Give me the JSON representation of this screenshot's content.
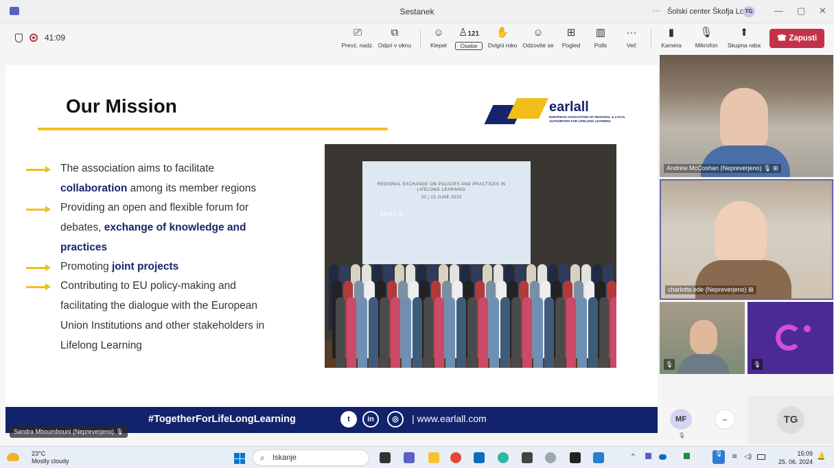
{
  "window": {
    "title": "Sestanek",
    "more": "···",
    "org": "Šolski center Škofja Loka",
    "org_badge": "TG",
    "minimize": "—",
    "restore": "▢",
    "close": "✕"
  },
  "toolbar": {
    "timer": "41:09",
    "buttons": [
      {
        "label": "Prevz. nadz.",
        "icon": "share-control-icon"
      },
      {
        "label": "Odpri v oknu",
        "icon": "popout-icon"
      },
      {
        "label": "Klepet",
        "icon": "chat-icon"
      },
      {
        "label": "Osebe",
        "icon": "people-icon",
        "count": "121"
      },
      {
        "label": "Dvigni roko",
        "icon": "raise-hand-icon"
      },
      {
        "label": "Odzovite se",
        "icon": "react-icon"
      },
      {
        "label": "Pogled",
        "icon": "view-icon"
      },
      {
        "label": "Polls",
        "icon": "polls-icon"
      },
      {
        "label": "Več",
        "icon": "more-icon"
      },
      {
        "label": "Kamera",
        "icon": "camera-off-icon"
      },
      {
        "label": "Mikrofon",
        "icon": "mic-off-icon"
      },
      {
        "label": "Skupna raba",
        "icon": "share-icon"
      }
    ],
    "leave_label": "Zapusti",
    "leave_color": "#c4314b"
  },
  "slide": {
    "title": "Our Mission",
    "logo_name": "earlall",
    "logo_sub": "EUROPEAN ASSOCIATION OF REGIONAL & LOCAL AUTHORITIES FOR LIFELONG LEARNING",
    "bullets": [
      {
        "lines": [
          "The association aims to facilitate",
          "",
          "collaboration",
          " among its member regions"
        ]
      },
      {
        "lines": [
          "Providing an open and flexible forum for",
          "debates, ",
          "exchange of knowledge and",
          "practices"
        ]
      },
      {
        "lines": [
          "Promoting ",
          "joint projects"
        ]
      },
      {
        "lines": [
          "Contributing to EU policy-making and",
          "facilitating the dialogue with the European",
          "Union Institutions and other stakeholders in",
          "Lifelong Learning"
        ]
      }
    ],
    "photo_banner": "REGIONAL EXCHANGE ON POLICIES AND PRACTICES IN LIFELONG LEARNING",
    "photo_date": "20 | 22 JUNE 2023",
    "photo_skill": "SKILLS",
    "footer_tag": "#TogetherForLifeLongLearning",
    "footer_url": "| www.earlall.com",
    "accent": "#f2be1a",
    "navy": "#12226b"
  },
  "presenter_label": "Sandra Mboumbouni (Nepreverjeno)",
  "participants": [
    {
      "name": "Andrew McCoshan (Nepreverjeno)"
    },
    {
      "name": "charlotte.ede (Nepreverjeno)"
    }
  ],
  "mini": {
    "mf": "MF",
    "dash": "–",
    "tg": "TG"
  },
  "taskbar": {
    "temp": "23°C",
    "weather": "Mostly cloudy",
    "search": "Iskanje",
    "time": "15:09",
    "date": "25. 06. 2024"
  }
}
